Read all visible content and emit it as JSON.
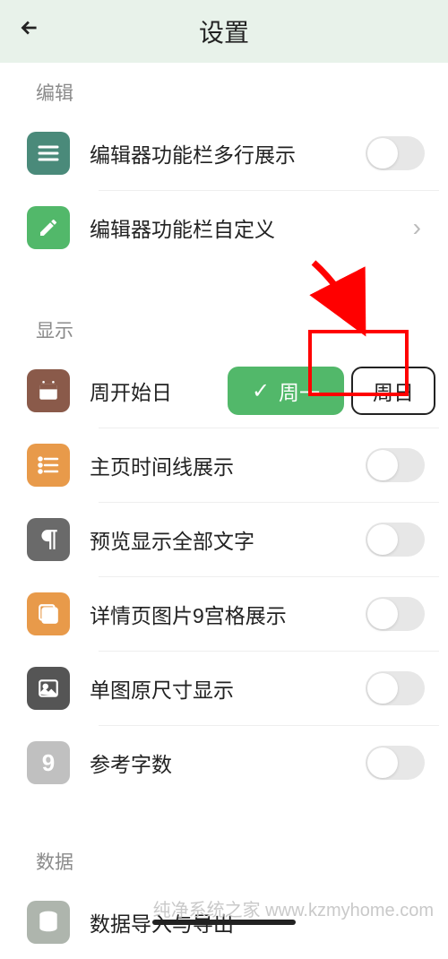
{
  "header": {
    "title": "设置"
  },
  "sections": {
    "edit": {
      "label": "编辑",
      "multiline": "编辑器功能栏多行展示",
      "customize": "编辑器功能栏自定义"
    },
    "display": {
      "label": "显示",
      "week_start": {
        "label": "周开始日",
        "monday": "周一",
        "sunday": "周日"
      },
      "timeline": "主页时间线展示",
      "preview_all": "预览显示全部文字",
      "grid_nine": "详情页图片9宫格展示",
      "original_size": "单图原尺寸显示",
      "word_count": "参考字数"
    },
    "data": {
      "label": "数据",
      "import_export": "数据导入与导出"
    }
  },
  "watermark": "纯净系统之家 www.kzmyhome.com"
}
